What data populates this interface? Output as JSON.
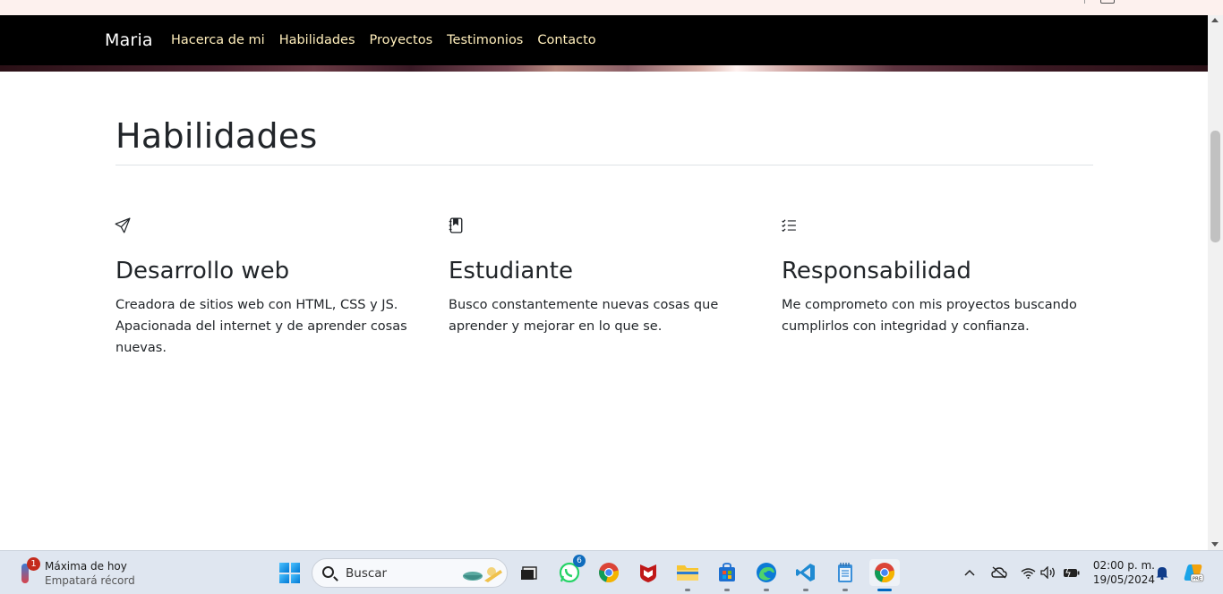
{
  "navbar": {
    "brand": "Maria",
    "links": [
      "Hacerca de mi",
      "Habilidades",
      "Proyectos",
      "Testimonios",
      "Contacto"
    ]
  },
  "section": {
    "title": "Habilidades",
    "skills": [
      {
        "icon": "send-icon",
        "title": "Desarrollo web",
        "text": "Creadora de sitios web con HTML, CSS y JS. Apacionada del internet y de aprender cosas nuevas."
      },
      {
        "icon": "journal-bookmark-icon",
        "title": "Estudiante",
        "text": "Busco constantemente nuevas cosas que aprender y mejorar en lo que se."
      },
      {
        "icon": "list-check-icon",
        "title": "Responsabilidad",
        "text": "Me comprometo con mis proyectos buscando cumplirlos con integridad y confianza."
      }
    ]
  },
  "taskbar": {
    "weather": {
      "title": "Máxima de hoy",
      "subtitle": "Empatará récord",
      "badge": "1"
    },
    "search_placeholder": "Buscar",
    "apps": [
      "file-manager-icon",
      "whatsapp-icon",
      "chrome-icon",
      "mcafee-icon",
      "folder-icon",
      "store-icon",
      "edge-icon",
      "vscode-icon",
      "notepad-icon",
      "chrome-active-icon"
    ],
    "whatsapp_badge": "6",
    "clock": {
      "time": "02:00 p. m.",
      "date": "19/05/2024"
    }
  },
  "colors": {
    "navbar_bg": "#000000",
    "nav_link": "#ffeebb",
    "brand": "#ffffff"
  }
}
